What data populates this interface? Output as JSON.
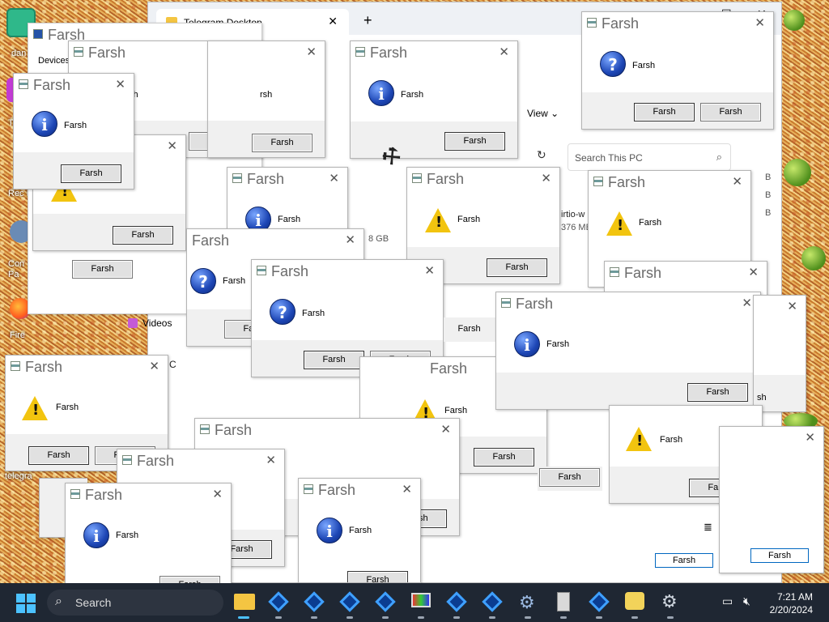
{
  "desktop": {
    "icons": [
      {
        "label": "dan"
      },
      {
        "label": "T"
      },
      {
        "label": "Rec B"
      },
      {
        "label": "Con Pa"
      },
      {
        "label": "Fire"
      },
      {
        "label": "telegra"
      }
    ]
  },
  "explorer": {
    "tab_title": "Telegram Desktop",
    "tab_close": "✕",
    "new_tab": "+",
    "devices_label": "Devices",
    "view_label": "View",
    "search_placeholder": "Search This PC",
    "drive_size": "8 GB",
    "virtio_label": "irtio-w",
    "virtio_size": "376 MB",
    "videos_label": "Videos",
    "this_pc_label": "C",
    "sizes": [
      "B",
      "B",
      "B"
    ],
    "bottom_buttons": [
      "Farsh",
      "Farsh"
    ]
  },
  "dialogs": [
    {
      "title": "Farsh",
      "message": "Farsh",
      "buttons": [
        "Farsh",
        "Farsh"
      ],
      "icon": "question-icon"
    },
    {
      "title": "Farsh",
      "message": "Farsh",
      "buttons": [
        "Farsh"
      ],
      "icon": "info-icon"
    },
    {
      "title": "Farsh",
      "message": "Farsh",
      "buttons": [
        "Farsh"
      ],
      "icon": "warning-icon"
    },
    {
      "title": "Farsh",
      "message": "Farsh",
      "buttons": [
        "Farsh"
      ],
      "icon": "question-icon"
    },
    {
      "title": "Farsh",
      "message": "Farsh",
      "buttons": [
        "Farsh",
        "Farsh"
      ],
      "icon": "question-icon"
    },
    {
      "title": "Farsh",
      "message": "Farsh",
      "buttons": [
        "Farsh"
      ],
      "icon": "info-icon"
    },
    {
      "title": "Farsh",
      "message": "Farsh",
      "buttons": [
        "Farsh",
        "Farsh"
      ],
      "icon": "warning-icon"
    },
    {
      "title": "Farsh",
      "message": "Farsh",
      "buttons": [
        "Farsh"
      ],
      "icon": "info-icon"
    },
    {
      "title": "Farsh",
      "message": "Farsh",
      "buttons": [
        "Farsh"
      ],
      "icon": "info-icon"
    }
  ],
  "farsh": "Farsh",
  "taskbar": {
    "search_label": "Search",
    "time": "7:21 AM",
    "date": "2/20/2024"
  }
}
